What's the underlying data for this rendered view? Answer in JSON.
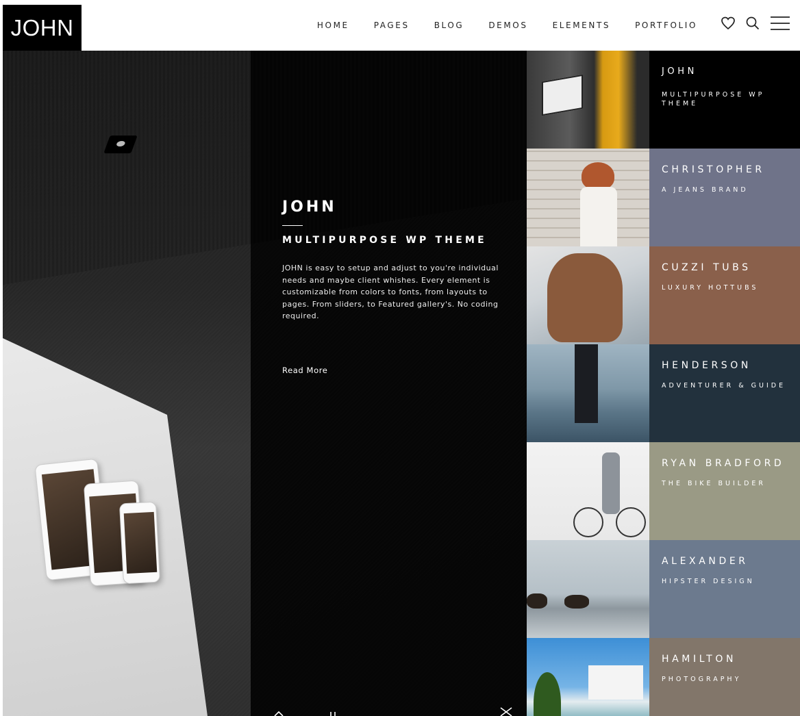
{
  "header": {
    "logo": "JOHN",
    "nav": [
      "HOME",
      "PAGES",
      "BLOG",
      "DEMOS",
      "ELEMENTS",
      "PORTFOLIO"
    ]
  },
  "icons": {
    "wishlist": "heart-icon",
    "search": "search-icon",
    "menu": "hamburger-menu-icon"
  },
  "hero": {
    "title": "JOHN",
    "subtitle": "MULTIPURPOSE WP THEME",
    "description": "JOHN is easy to setup and adjust to you're individual needs and maybe client whishes. Every element is customizable from colors to fonts, from layouts to pages. From sliders, to Featured gallery's. No coding required.",
    "read_more": "Read More"
  },
  "portfolio": [
    {
      "name": "JOHN",
      "subtitle": "MULTIPURPOSE WP THEME",
      "color": "#000000"
    },
    {
      "name": "CHRISTOPHER",
      "subtitle": "A JEANS BRAND",
      "color": "#6f7389"
    },
    {
      "name": "CUZZI TUBS",
      "subtitle": "LUXURY HOTTUBS",
      "color": "#8a604b"
    },
    {
      "name": "HENDERSON",
      "subtitle": "ADVENTURER & GUIDE",
      "color": "#22313d"
    },
    {
      "name": "RYAN BRADFORD",
      "subtitle": "THE BIKE BUILDER",
      "color": "#9a9a85"
    },
    {
      "name": "ALEXANDER",
      "subtitle": "HIPSTER DESIGN",
      "color": "#6c7a8e"
    },
    {
      "name": "HAMILTON",
      "subtitle": "PHOTOGRAPHY",
      "color": "#82766a"
    }
  ]
}
